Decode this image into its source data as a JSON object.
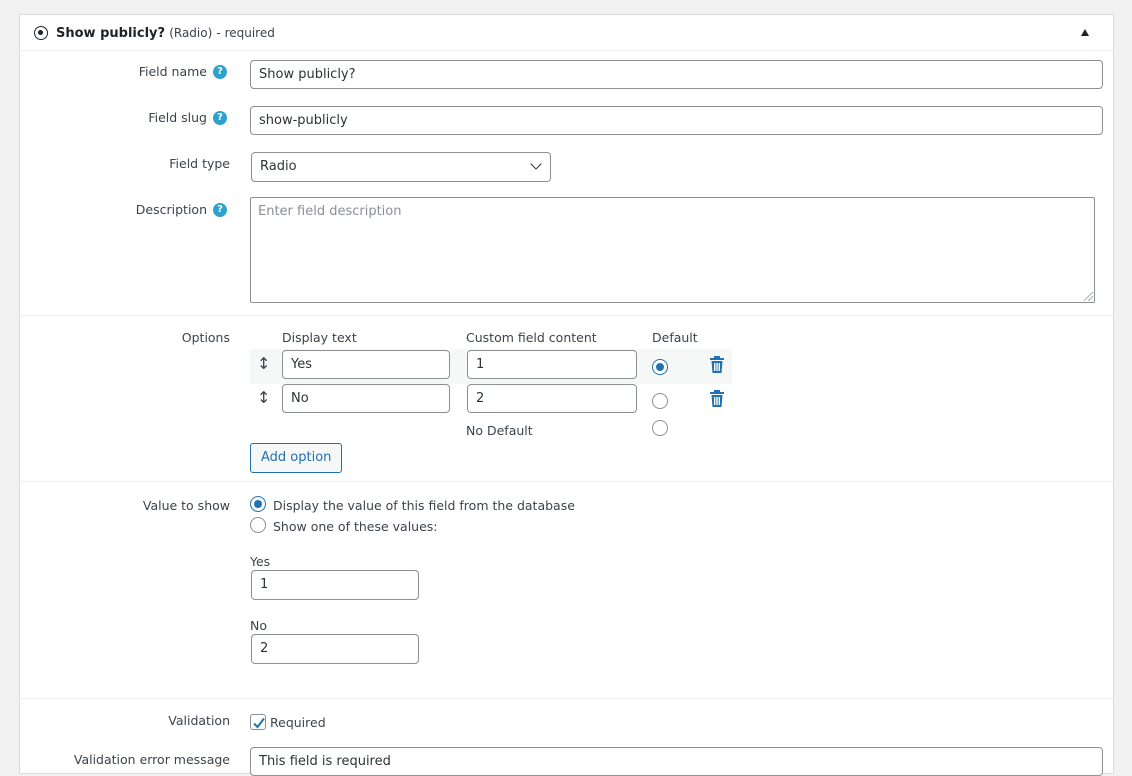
{
  "header": {
    "title": "Show publicly?",
    "type": "(Radio)",
    "required": "- required"
  },
  "fields": {
    "name": {
      "label": "Field name",
      "value": "Show publicly?"
    },
    "slug": {
      "label": "Field slug",
      "value": "show-publicly"
    },
    "type": {
      "label": "Field type",
      "value": "Radio"
    },
    "description": {
      "label": "Description",
      "placeholder": "Enter field description"
    }
  },
  "options": {
    "label": "Options",
    "columns": {
      "display": "Display text",
      "content": "Custom field content",
      "default": "Default"
    },
    "rows": [
      {
        "display": "Yes",
        "content": "1",
        "default": true
      },
      {
        "display": "No",
        "content": "2",
        "default": false
      }
    ],
    "no_default": "No Default",
    "add_button": "Add option"
  },
  "value_to_show": {
    "label": "Value to show",
    "choice_db": "Display the value of this field from the database",
    "choice_values": "Show one of these values:",
    "values": [
      {
        "label": "Yes",
        "value": "1"
      },
      {
        "label": "No",
        "value": "2"
      }
    ]
  },
  "validation": {
    "label": "Validation",
    "required_label": "Required",
    "error_label": "Validation error message",
    "error_value": "This field is required"
  },
  "colors": {
    "accent": "#2271b1",
    "help": "#2ea2cc"
  }
}
